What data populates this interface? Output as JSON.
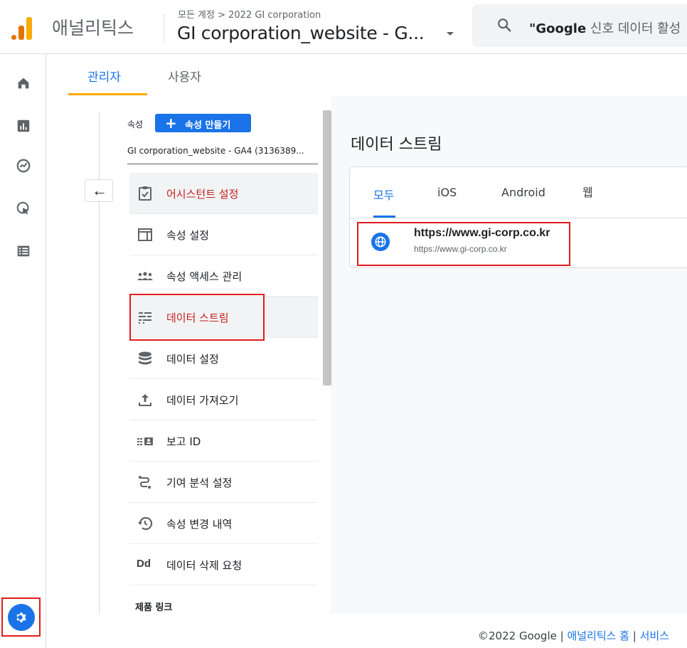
{
  "header": {
    "app_title": "애널리틱스",
    "breadcrumb": "모든 계정 > 2022 GI corporation",
    "property_name": "GI corporation_website - G...",
    "search_placeholder_bold": "\"Google",
    "search_placeholder_rest": " 신호 데이터 활성"
  },
  "admin_tabs": {
    "admin": "관리자",
    "user": "사용자"
  },
  "property_panel": {
    "label": "속성",
    "create_button": "속성 만들기",
    "selected_property": "GI corporation_website - GA4 (3136389...",
    "menu": [
      {
        "label": "어시스턴트 설정",
        "icon": "checklist-icon"
      },
      {
        "label": "속성 설정",
        "icon": "property-settings-icon"
      },
      {
        "label": "속성 액세스 관리",
        "icon": "people-icon"
      },
      {
        "label": "데이터 스트림",
        "icon": "data-stream-icon"
      },
      {
        "label": "데이터 설정",
        "icon": "database-icon"
      },
      {
        "label": "데이터 가져오기",
        "icon": "upload-icon"
      },
      {
        "label": "보고 ID",
        "icon": "reporting-id-icon"
      },
      {
        "label": "기여 분석 설정",
        "icon": "attribution-icon"
      },
      {
        "label": "속성 변경 내역",
        "icon": "history-icon"
      },
      {
        "label": "데이터 삭제 요청",
        "icon": "data-deletion-icon"
      }
    ],
    "footer_label": "제품 링크"
  },
  "data_streams": {
    "title": "데이터 스트림",
    "tabs": [
      "모두",
      "iOS",
      "Android",
      "웹"
    ],
    "stream": {
      "title": "https://www.gi-corp.co.kr",
      "subtitle": "https://www.gi-corp.co.kr"
    }
  },
  "footer": {
    "copyright": "©2022 Google | ",
    "link1": "애널리틱스 홈",
    "sep": " | ",
    "link2": "서비스"
  },
  "colors": {
    "accent": "#1a73e8",
    "highlight": "#e01b1b",
    "selected_text": "#c5221f",
    "tab_underline": "#f9ab00"
  }
}
